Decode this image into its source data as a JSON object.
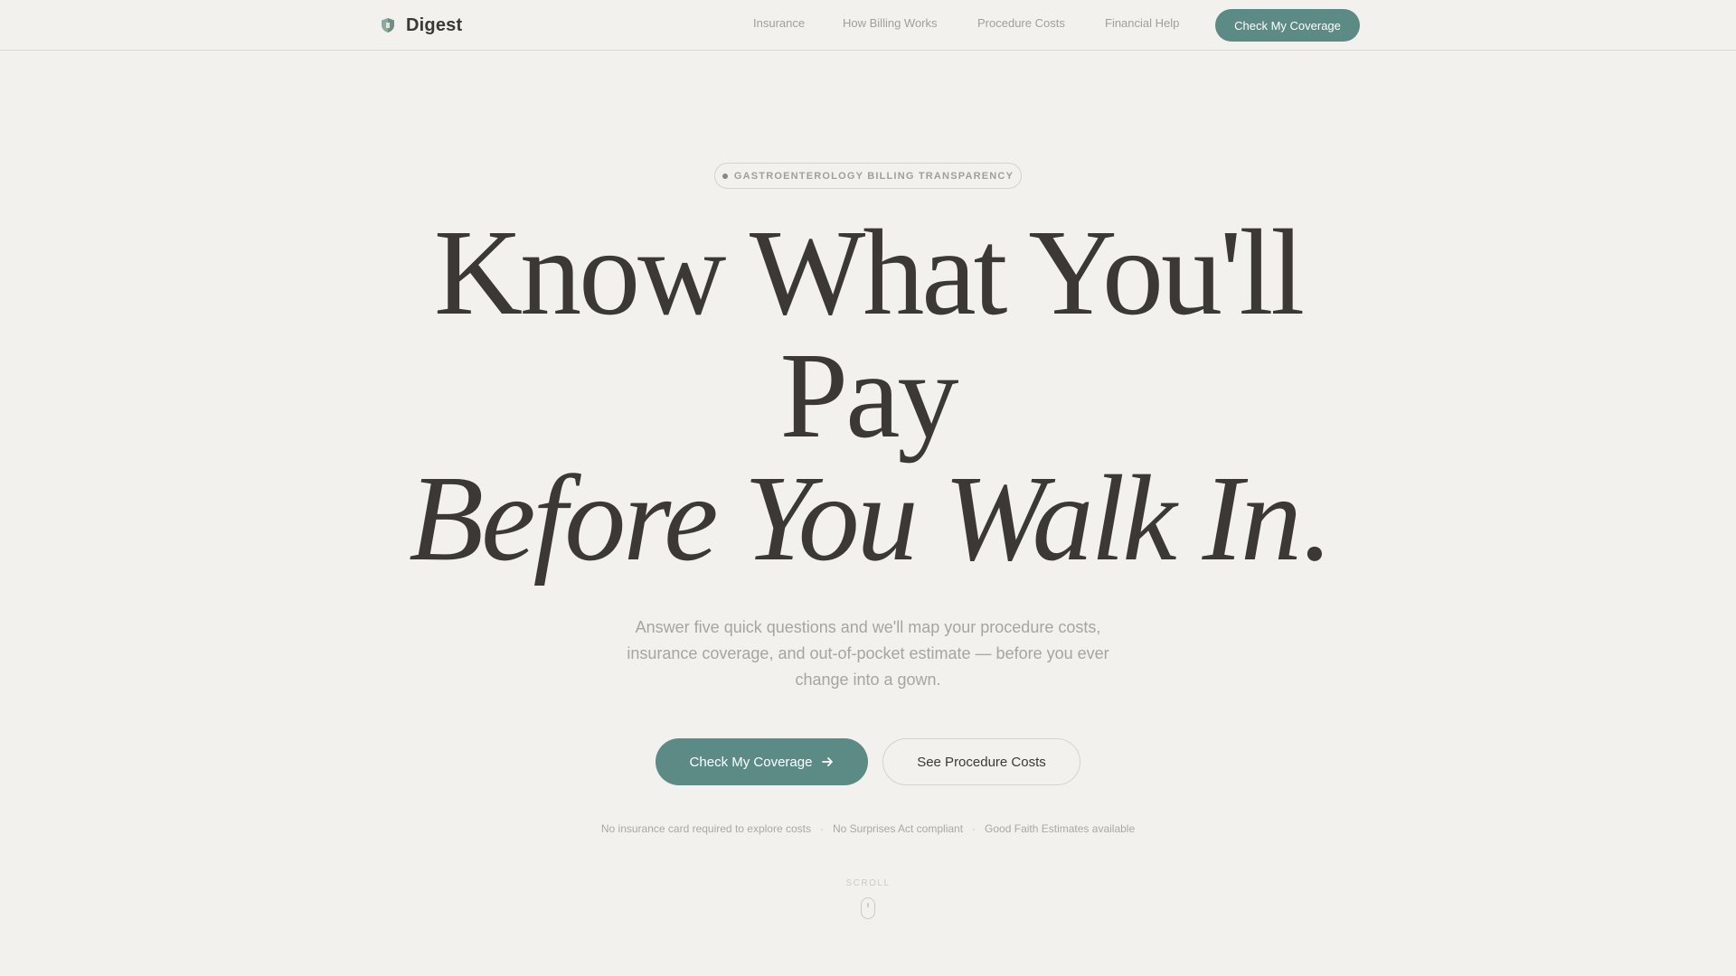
{
  "nav": {
    "brand": "Digest",
    "links": [
      "Insurance",
      "How Billing Works",
      "Procedure Costs",
      "Financial Help"
    ],
    "cta": "Check My Coverage"
  },
  "hero": {
    "badge": "GASTROENTEROLOGY BILLING TRANSPARENCY",
    "title_line1": "Know What You'll",
    "title_line2": "Pay",
    "title_line3": "Before You Walk In",
    "title_end": ".",
    "lede": "Answer five quick questions and we'll map your procedure costs, insurance coverage, and out-of-pocket estimate — before you ever change into a gown.",
    "primary_button": "Check My Coverage",
    "secondary_button": "See Procedure Costs",
    "trust_items": [
      "No insurance card required to explore costs",
      "No Surprises Act compliant",
      "Good Faith Estimates available"
    ],
    "trust_separator": "·",
    "scroll_label": "SCROLL"
  },
  "colors": {
    "background": "#f3f1ee",
    "accent": "#5c8a84",
    "text": "#3b3836",
    "muted": "#a29e99"
  },
  "icons": {
    "brand": "shield-logo-icon",
    "arrow": "arrow-right-icon",
    "scroll": "mouse-scroll-icon"
  }
}
